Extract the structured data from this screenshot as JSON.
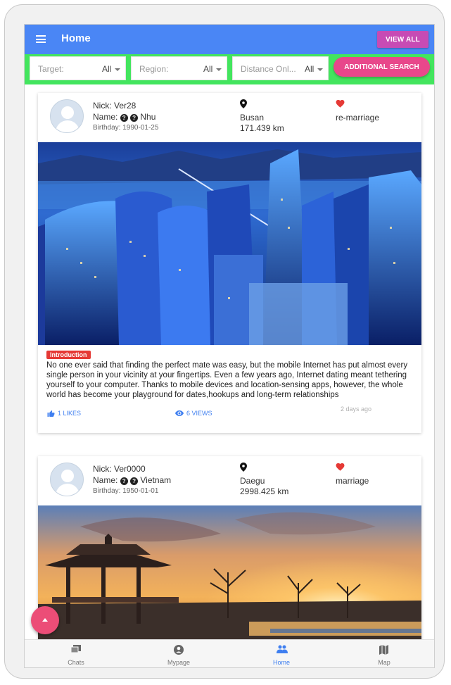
{
  "header": {
    "title": "Home",
    "view_all_label": "VIEW ALL"
  },
  "filters": {
    "target": {
      "placeholder": "Target:",
      "value": "All"
    },
    "region": {
      "placeholder": "Region:",
      "value": "All"
    },
    "distance": {
      "placeholder": "Distance Onl...",
      "value": "All"
    },
    "additional_search_label": "ADDITIONAL SEARCH"
  },
  "posts": [
    {
      "nick": "Nick: Ver28",
      "name_prefix": "Name:",
      "name": "Nhu",
      "birthday": "Birthday: 1990-01-25",
      "city": "Busan",
      "distance": "171.439 km",
      "purpose": "re-marriage",
      "intro_badge": "Introduction",
      "description": "No one ever said that finding the perfect mate was easy, but the mobile Internet has put almost every single person in your vicinity at your fingertips. Even a few years ago, Internet dating meant tethering yourself to your computer. Thanks to mobile devices and location-sensing apps, however, the whole world has become your playground for dates,hookups and long-term relationships",
      "likes": "1 LIKES",
      "views": "6 VIEWS",
      "posted": "2 days ago"
    },
    {
      "nick": "Nick: Ver0000",
      "name_prefix": "Name:",
      "name": "Vietnam",
      "birthday": "Birthday: 1950-01-01",
      "city": "Daegu",
      "distance": "2998.425 km",
      "purpose": "marriage"
    }
  ],
  "nav": {
    "chats": "Chats",
    "mypage": "Mypage",
    "home": "Home",
    "map": "Map"
  },
  "colors": {
    "appbar": "#4a86f5",
    "filterbar": "#43e55e",
    "view_all": "#c74bb4",
    "additional_search": "#e8478b",
    "fab": "#ec4d77",
    "active_nav": "#3f7ff0"
  },
  "icons": {
    "menu": "menu-icon",
    "location": "location-pin-icon",
    "heart": "heart-icon",
    "like": "thumb-up-icon",
    "views": "eye-icon",
    "chats": "chat-icon",
    "mypage": "account-icon",
    "home": "people-icon",
    "map": "map-icon",
    "fab": "arrow-up-icon"
  }
}
